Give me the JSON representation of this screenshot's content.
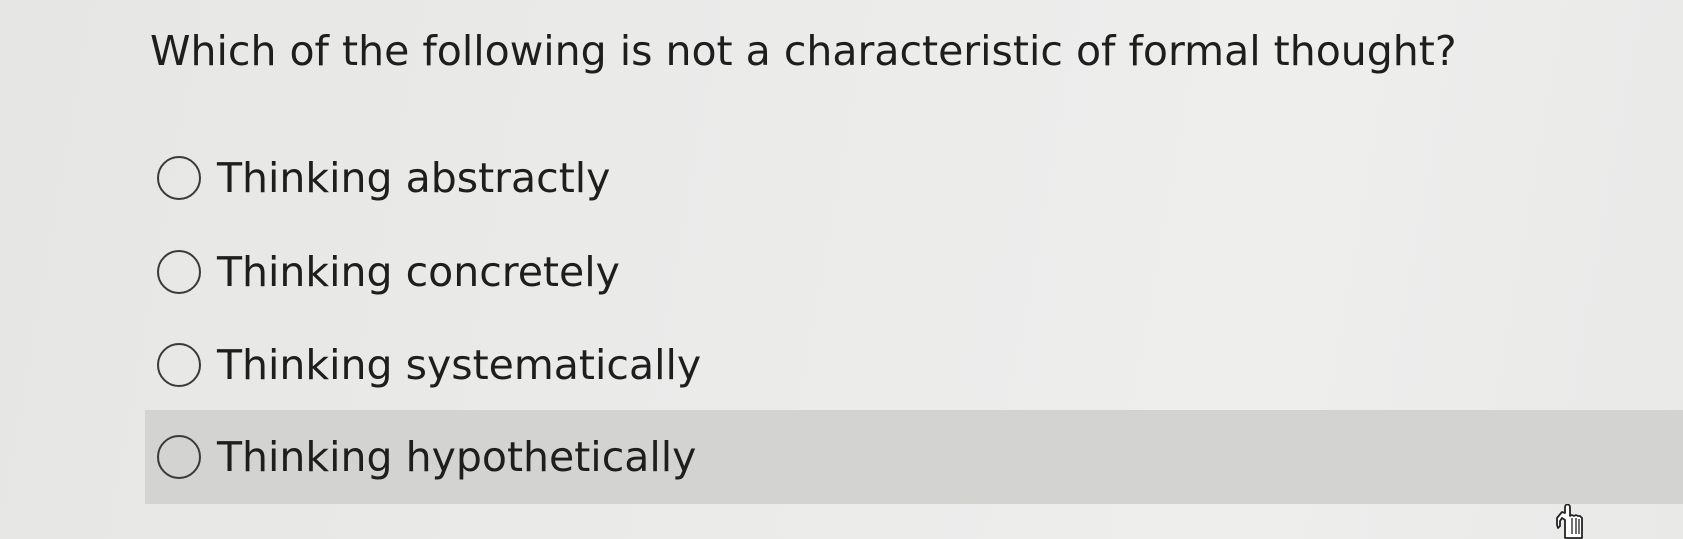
{
  "question": {
    "text": "Which of the following is not a characteristic of formal thought?"
  },
  "options": [
    {
      "label": "Thinking abstractly",
      "selected": false,
      "hovered": false
    },
    {
      "label": "Thinking concretely",
      "selected": false,
      "hovered": false
    },
    {
      "label": "Thinking systematically",
      "selected": false,
      "hovered": false
    },
    {
      "label": "Thinking hypothetically",
      "selected": false,
      "hovered": true
    }
  ],
  "colors": {
    "text": "#1e1e1e",
    "hover_background": "#d3d3d2",
    "radio_border": "#3a3a3a"
  },
  "cursor": {
    "icon": "hand-pointer-icon"
  }
}
